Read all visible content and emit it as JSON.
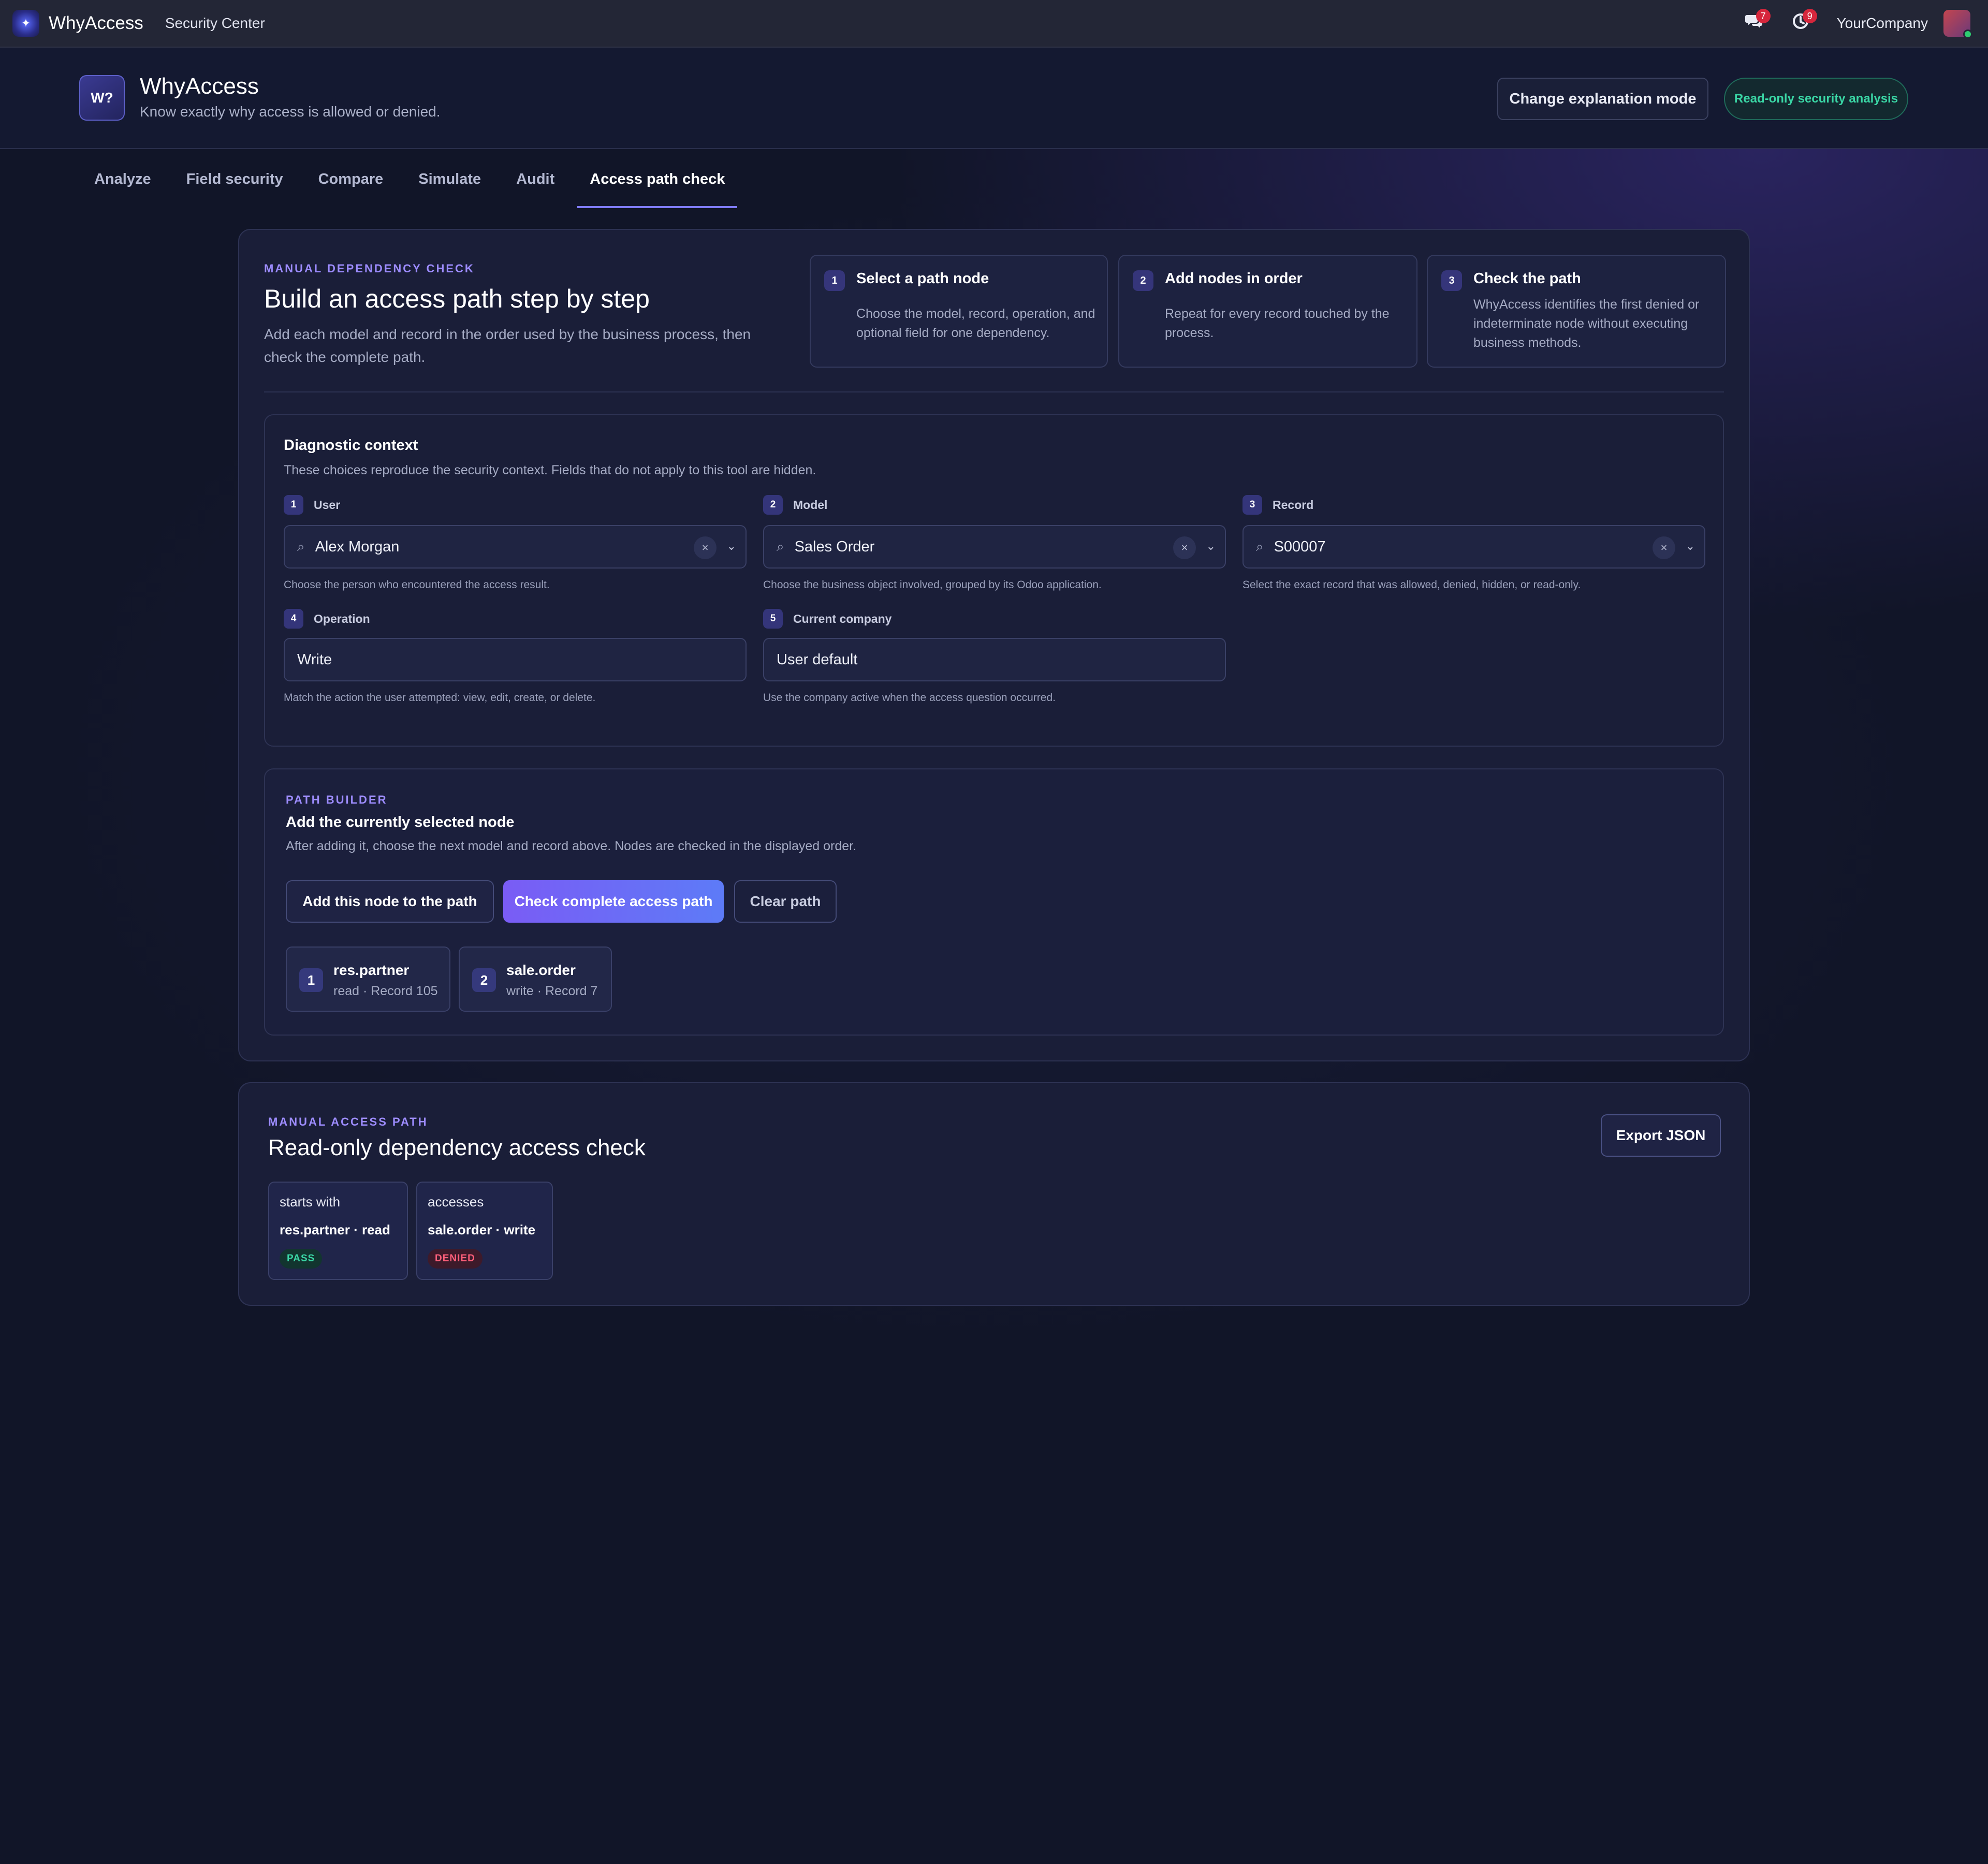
{
  "navbar": {
    "app_name": "WhyAccess",
    "menu": "Security Center",
    "messages_count": "7",
    "activity_count": "9",
    "company": "YourCompany"
  },
  "header": {
    "logo_text": "W?",
    "title": "WhyAccess",
    "subtitle": "Know exactly why access is allowed or denied.",
    "mode_button": "Change explanation mode",
    "readonly_badge": "Read-only security analysis"
  },
  "tabs": [
    {
      "label": "Analyze"
    },
    {
      "label": "Field security"
    },
    {
      "label": "Compare"
    },
    {
      "label": "Simulate"
    },
    {
      "label": "Audit"
    },
    {
      "label": "Access path check",
      "active": true
    }
  ],
  "intro": {
    "eyebrow": "MANUAL DEPENDENCY CHECK",
    "title": "Build an access path step by step",
    "description": "Add each model and record in the order used by the business process, then check the complete path."
  },
  "steps": [
    {
      "num": "1",
      "title": "Select a path node",
      "desc": "Choose the model, record, operation, and optional field for one dependency."
    },
    {
      "num": "2",
      "title": "Add nodes in order",
      "desc": "Repeat for every record touched by the process."
    },
    {
      "num": "3",
      "title": "Check the path",
      "desc": "WhyAccess identifies the first denied or indeterminate node without executing business methods."
    }
  ],
  "context": {
    "title": "Diagnostic context",
    "description": "These choices reproduce the security context. Fields that do not apply to this tool are hidden.",
    "fields": [
      {
        "num": "1",
        "label": "User",
        "value": "Alex Morgan",
        "help": "Choose the person who encountered the access result."
      },
      {
        "num": "2",
        "label": "Model",
        "value": "Sales Order",
        "help": "Choose the business object involved, grouped by its Odoo application."
      },
      {
        "num": "3",
        "label": "Record",
        "value": "S00007",
        "help": "Select the exact record that was allowed, denied, hidden, or read-only."
      },
      {
        "num": "4",
        "label": "Operation",
        "value": "Write",
        "help": "Match the action the user attempted: view, edit, create, or delete."
      },
      {
        "num": "5",
        "label": "Current company",
        "value": "User default",
        "help": "Use the company active when the access question occurred."
      }
    ]
  },
  "path_builder": {
    "eyebrow": "PATH BUILDER",
    "title": "Add the currently selected node",
    "description": "After adding it, choose the next model and record above. Nodes are checked in the displayed order.",
    "add_button": "Add this node to the path",
    "check_button": "Check complete access path",
    "clear_button": "Clear path",
    "nodes": [
      {
        "num": "1",
        "model": "res.partner",
        "detail": "read · Record 105"
      },
      {
        "num": "2",
        "model": "sale.order",
        "detail": "write · Record 7"
      }
    ]
  },
  "result": {
    "eyebrow": "MANUAL ACCESS PATH",
    "title": "Read-only dependency access check",
    "export_button": "Export JSON",
    "nodes": [
      {
        "relation": "starts with",
        "node": "res.partner · read",
        "status": "PASS"
      },
      {
        "relation": "accesses",
        "node": "sale.order · write",
        "status": "DENIED"
      }
    ]
  },
  "colors": {
    "accent": "#7f7bff",
    "pass": "#3ad6a5",
    "denied": "#ff5f7a",
    "background": "#111528"
  }
}
